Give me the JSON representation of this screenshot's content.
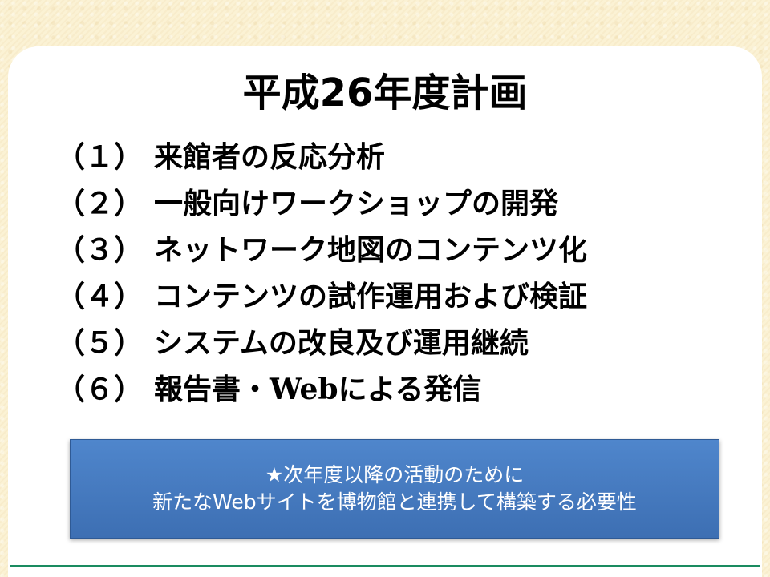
{
  "slide": {
    "title": "平成26年度計画",
    "items": [
      {
        "number": "（１）",
        "text": "来館者の反応分析"
      },
      {
        "number": "（２）",
        "text": "一般向けワークショップの開発"
      },
      {
        "number": "（３）",
        "text": "ネットワーク地図のコンテンツ化"
      },
      {
        "number": "（４）",
        "text": "コンテンツの試作運用および検証"
      },
      {
        "number": "（５）",
        "text": "システムの改良及び運用継続"
      },
      {
        "number": "（６）",
        "text": "報告書・Webによる発信"
      }
    ],
    "note": {
      "line1": "★次年度以降の活動のために",
      "line2": "新たなWebサイトを博物館と連携して構築する必要性"
    }
  },
  "colors": {
    "background": "#fbf1d2",
    "card": "#ffffff",
    "note_box": "#4a7fc2",
    "note_text": "#ffffff",
    "rule": "#1a8b60"
  }
}
